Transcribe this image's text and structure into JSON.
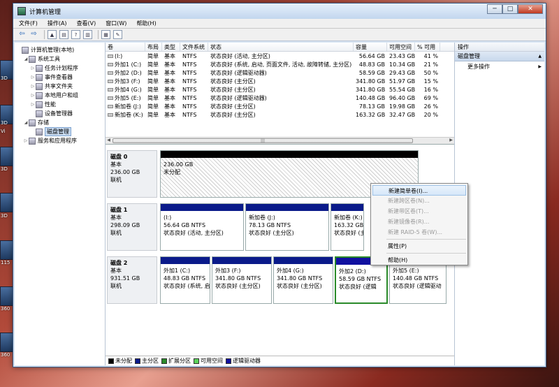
{
  "desktop": {
    "labels": [
      "3D",
      "3D",
      "Vi",
      "3D",
      "3D",
      "115",
      "360",
      "360"
    ]
  },
  "window": {
    "title": "计算机管理",
    "min": "─",
    "max": "□",
    "close": "✕"
  },
  "menu": [
    "文件(F)",
    "操作(A)",
    "查看(V)",
    "窗口(W)",
    "帮助(H)"
  ],
  "tree": [
    {
      "label": "计算机管理(本地)",
      "indent": 0,
      "tw": ""
    },
    {
      "label": "系统工具",
      "indent": 1,
      "tw": "◢"
    },
    {
      "label": "任务计划程序",
      "indent": 2,
      "tw": "▷"
    },
    {
      "label": "事件查看器",
      "indent": 2,
      "tw": "▷"
    },
    {
      "label": "共享文件夹",
      "indent": 2,
      "tw": "▷"
    },
    {
      "label": "本地用户和组",
      "indent": 2,
      "tw": "▷"
    },
    {
      "label": "性能",
      "indent": 2,
      "tw": "▷"
    },
    {
      "label": "设备管理器",
      "indent": 2,
      "tw": ""
    },
    {
      "label": "存储",
      "indent": 1,
      "tw": "◢"
    },
    {
      "label": "磁盘管理",
      "indent": 2,
      "tw": "",
      "selected": true
    },
    {
      "label": "服务和应用程序",
      "indent": 1,
      "tw": "▷"
    }
  ],
  "volume_table": {
    "headers": [
      "卷",
      "布局",
      "类型",
      "文件系统",
      "状态",
      "容量",
      "可用空间",
      "% 可用"
    ],
    "rows": [
      [
        "(I:)",
        "简单",
        "基本",
        "NTFS",
        "状态良好 (活动, 主分区)",
        "56.64 GB",
        "23.43 GB",
        "41 %"
      ],
      [
        "外加1 (C:)",
        "简单",
        "基本",
        "NTFS",
        "状态良好 (系统, 启动, 页面文件, 活动, 故障转储, 主分区)",
        "48.83 GB",
        "10.34 GB",
        "21 %"
      ],
      [
        "外加2 (D:)",
        "简单",
        "基本",
        "NTFS",
        "状态良好 (逻辑驱动器)",
        "58.59 GB",
        "29.43 GB",
        "50 %"
      ],
      [
        "外加3 (F:)",
        "简单",
        "基本",
        "NTFS",
        "状态良好 (主分区)",
        "341.80 GB",
        "51.97 GB",
        "15 %"
      ],
      [
        "外加4 (G:)",
        "简单",
        "基本",
        "NTFS",
        "状态良好 (主分区)",
        "341.80 GB",
        "55.54 GB",
        "16 %"
      ],
      [
        "外加5 (E:)",
        "简单",
        "基本",
        "NTFS",
        "状态良好 (逻辑驱动器)",
        "140.48 GB",
        "96.40 GB",
        "69 %"
      ],
      [
        "新加卷 (J:)",
        "简单",
        "基本",
        "NTFS",
        "状态良好 (主分区)",
        "78.13 GB",
        "19.98 GB",
        "26 %"
      ],
      [
        "新加卷 (K:)",
        "简单",
        "基本",
        "NTFS",
        "状态良好 (主分区)",
        "163.32 GB",
        "32.47 GB",
        "20 %"
      ]
    ]
  },
  "disks": [
    {
      "name": "磁盘 0",
      "type": "基本",
      "size": "236.00 GB",
      "status": "联机",
      "parts": [
        {
          "bar": "black",
          "line1": "",
          "line2": "236.00 GB",
          "line3": "未分配",
          "unalloc": true
        }
      ]
    },
    {
      "name": "磁盘 1",
      "type": "基本",
      "size": "298.09 GB",
      "status": "联机",
      "parts": [
        {
          "bar": "navy",
          "line1": "(I:)",
          "line2": "56.64 GB NTFS",
          "line3": "状态良好 (活动, 主分区)"
        },
        {
          "bar": "navy",
          "line1": "新加卷 (J:)",
          "line2": "78.13 GB NTFS",
          "line3": "状态良好 (主分区)"
        },
        {
          "bar": "navy",
          "line1": "新加卷 (K:)",
          "line2": "163.32 GB N",
          "line3": "状态良好 (主"
        }
      ]
    },
    {
      "name": "磁盘 2",
      "type": "基本",
      "size": "931.51 GB",
      "status": "联机",
      "parts": [
        {
          "bar": "navy",
          "line1": "外加1 (C:)",
          "line2": "48.83 GB NTFS",
          "line3": "状态良好 (系统, 启"
        },
        {
          "bar": "navy",
          "line1": "外加3 (F:)",
          "line2": "341.80 GB NTFS",
          "line3": "状态良好 (主分区)"
        },
        {
          "bar": "navy",
          "line1": "外加4 (G:)",
          "line2": "341.80 GB NTFS",
          "line3": "状态良好 (主分区)"
        },
        {
          "bar": "blue",
          "line1": "外加2 (D:)",
          "line2": "58.59 GB NTFS",
          "line3": "状态良好 (逻辑"
        },
        {
          "bar": "blue",
          "line1": "外加5 (E:)",
          "line2": "140.48 GB NTFS",
          "line3": "状态良好 (逻辑驱动"
        }
      ]
    }
  ],
  "legend": [
    {
      "label": "未分配",
      "color": "#000000"
    },
    {
      "label": "主分区",
      "color": "#0a1a8a"
    },
    {
      "label": "扩展分区",
      "color": "#2a8a2a"
    },
    {
      "label": "可用空间",
      "color": "#5ad25a"
    },
    {
      "label": "逻辑驱动器",
      "color": "#1010a0"
    }
  ],
  "actions": {
    "header": "操作",
    "section": "磁盘管理",
    "section_arrow": "▲",
    "more": "更多操作",
    "more_arrow": "▶"
  },
  "context_menu": {
    "items": [
      {
        "label": "新建简单卷(I)...",
        "disabled": false,
        "highlight": true
      },
      {
        "label": "新建跨区卷(N)...",
        "disabled": true
      },
      {
        "label": "新建带区卷(T)...",
        "disabled": true
      },
      {
        "label": "新建镜像卷(R)...",
        "disabled": true
      },
      {
        "label": "新建 RAID-5 卷(W)...",
        "disabled": true
      },
      {
        "sep": true
      },
      {
        "label": "属性(P)",
        "disabled": false
      },
      {
        "sep": true
      },
      {
        "label": "帮助(H)",
        "disabled": false
      }
    ]
  },
  "scroll_grip": "|||"
}
